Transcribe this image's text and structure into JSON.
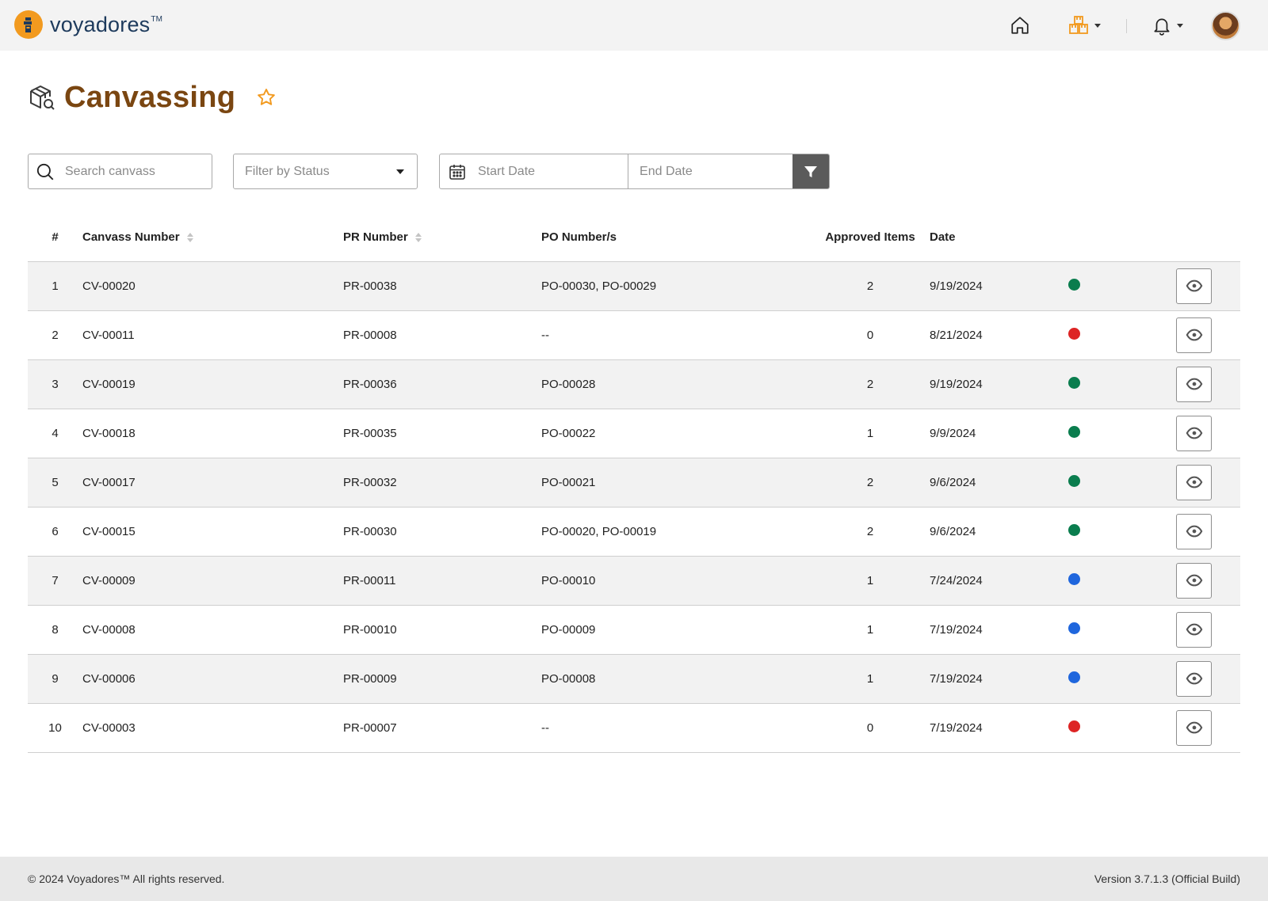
{
  "app": {
    "brand": "voyadores",
    "trademark": "TM",
    "accent_color": "#f29a1f",
    "title_color": "#7a4611"
  },
  "nav": {
    "home_icon": "home-icon",
    "inventory_icon": "boxes-icon",
    "notifications_icon": "bell-icon"
  },
  "page": {
    "title": "Canvassing",
    "title_icon": "box-search-icon"
  },
  "filters": {
    "search_placeholder": "Search canvass",
    "status_placeholder": "Filter by Status",
    "start_date_placeholder": "Start Date",
    "end_date_placeholder": "End Date"
  },
  "table": {
    "headers": {
      "num": "#",
      "canvass_number": "Canvass Number",
      "pr_number": "PR Number",
      "po_numbers": "PO Number/s",
      "approved_items": "Approved Items",
      "date": "Date"
    },
    "status_colors": {
      "green": "#0a7d4e",
      "red": "#dd2424",
      "blue": "#1f66dd"
    },
    "rows": [
      {
        "num": "1",
        "canvass": "CV-00020",
        "pr": "PR-00038",
        "po": "PO-00030, PO-00029",
        "approved": "2",
        "date": "9/19/2024",
        "status": "green"
      },
      {
        "num": "2",
        "canvass": "CV-00011",
        "pr": "PR-00008",
        "po": "--",
        "approved": "0",
        "date": "8/21/2024",
        "status": "red"
      },
      {
        "num": "3",
        "canvass": "CV-00019",
        "pr": "PR-00036",
        "po": "PO-00028",
        "approved": "2",
        "date": "9/19/2024",
        "status": "green"
      },
      {
        "num": "4",
        "canvass": "CV-00018",
        "pr": "PR-00035",
        "po": "PO-00022",
        "approved": "1",
        "date": "9/9/2024",
        "status": "green"
      },
      {
        "num": "5",
        "canvass": "CV-00017",
        "pr": "PR-00032",
        "po": "PO-00021",
        "approved": "2",
        "date": "9/6/2024",
        "status": "green"
      },
      {
        "num": "6",
        "canvass": "CV-00015",
        "pr": "PR-00030",
        "po": "PO-00020, PO-00019",
        "approved": "2",
        "date": "9/6/2024",
        "status": "green"
      },
      {
        "num": "7",
        "canvass": "CV-00009",
        "pr": "PR-00011",
        "po": "PO-00010",
        "approved": "1",
        "date": "7/24/2024",
        "status": "blue"
      },
      {
        "num": "8",
        "canvass": "CV-00008",
        "pr": "PR-00010",
        "po": "PO-00009",
        "approved": "1",
        "date": "7/19/2024",
        "status": "blue"
      },
      {
        "num": "9",
        "canvass": "CV-00006",
        "pr": "PR-00009",
        "po": "PO-00008",
        "approved": "1",
        "date": "7/19/2024",
        "status": "blue"
      },
      {
        "num": "10",
        "canvass": "CV-00003",
        "pr": "PR-00007",
        "po": "--",
        "approved": "0",
        "date": "7/19/2024",
        "status": "red"
      }
    ]
  },
  "footer": {
    "copyright": "© 2024 Voyadores™ All rights reserved.",
    "version": "Version 3.7.1.3 (Official Build)"
  }
}
